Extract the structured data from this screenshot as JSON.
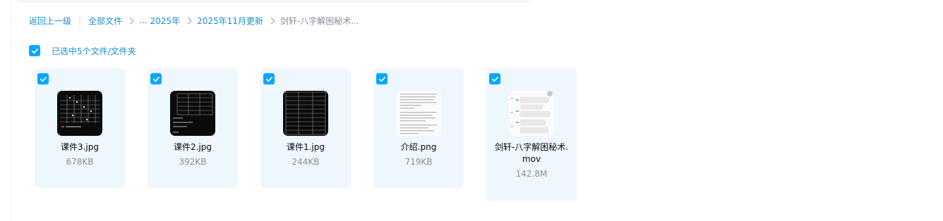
{
  "breadcrumb": {
    "back_label": "返回上一级",
    "all_files_label": "全部文件",
    "ellipsis": "...",
    "items": [
      "2025年",
      "2025年11月更新"
    ],
    "current": "剑轩-八字解困秘术..."
  },
  "selection": {
    "summary": "已选中5个文件/文件夹",
    "all_checked": true
  },
  "files": [
    {
      "name": "课件3.jpg",
      "size": "678KB",
      "checked": true,
      "thumb": "dark-image-thumbnail"
    },
    {
      "name": "课件2.jpg",
      "size": "392KB",
      "checked": true,
      "thumb": "dark-table-thumbnail"
    },
    {
      "name": "课件1.jpg",
      "size": "244KB",
      "checked": true,
      "thumb": "dark-table-thumbnail"
    },
    {
      "name": "介绍.png",
      "size": "719KB",
      "checked": true,
      "thumb": "text-document-thumbnail"
    },
    {
      "name": "剑轩-八字解困秘术.mov",
      "size": "142.8M",
      "checked": true,
      "thumb": "chat-screenshot-thumbnail"
    }
  ],
  "colors": {
    "accent": "#06a7ff",
    "link": "#1c8fcf",
    "card_bg": "#eef7fd",
    "muted_text": "#878c9c"
  }
}
